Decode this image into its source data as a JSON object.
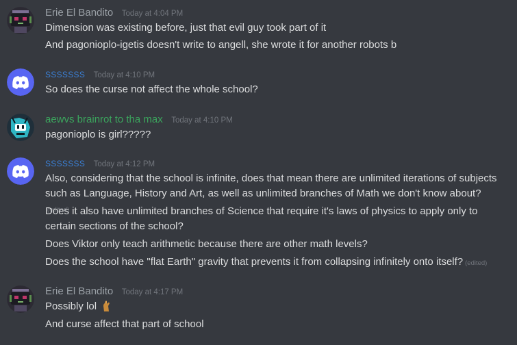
{
  "colors": {
    "background": "#36393f",
    "text": "#dcddde",
    "muted": "#72767d",
    "discord_blurple": "#5865f2",
    "author_erie": "#9aa0a6",
    "author_sss": "#3b7fd4",
    "author_aewvs": "#3ba55d"
  },
  "messages": [
    {
      "author": "Erie El Bandito",
      "timestamp": "Today at 4:04 PM",
      "avatar_icon": "dark-robot-avatar",
      "lines": [
        "Dimension was existing before, just that evil guy took part of it",
        "And pagonioplo-igetis doesn't write to angell, she wrote it for another robots b"
      ]
    },
    {
      "author": "SSSSSSS",
      "timestamp": "Today at 4:10 PM",
      "avatar_icon": "discord-default-avatar",
      "lines": [
        "So does the curse not affect the whole school?"
      ]
    },
    {
      "author": "aewvs brainrot to tha max",
      "timestamp": "Today at 4:10 PM",
      "avatar_icon": "cyan-character-avatar",
      "lines": [
        "pagonioplo is girl?????"
      ]
    },
    {
      "author": "SSSSSSS",
      "timestamp": "Today at 4:12 PM",
      "avatar_icon": "discord-default-avatar",
      "lines": [
        "Also, considering that the school is infinite, does that mean there are unlimited iterations of subjects",
        "such as Language, History and Art, as well as unlimited branches of Math we don't know about?",
        "Does it also have unlimited branches of Science that require it's laws of physics to apply only to",
        "certain sections of the school?",
        "Does Viktor only teach arithmetic because there are other math levels?",
        "Does the school have \"flat Earth\" gravity that prevents it from collapsing infinitely onto itself?"
      ],
      "edited_label": "(edited)"
    },
    {
      "author": "Erie El Bandito",
      "timestamp": "Today at 4:17 PM",
      "avatar_icon": "dark-robot-avatar",
      "lines": [
        "Possibly lol",
        "And curse affect that part of school"
      ],
      "emoji": "pinching-hand-emoji"
    }
  ]
}
